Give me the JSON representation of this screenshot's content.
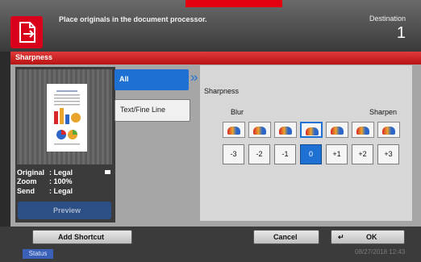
{
  "header": {
    "message": "Place originals in the document processor.",
    "destination_label": "Destination",
    "destination_count": "1"
  },
  "title": "Sharpness",
  "preview": {
    "original": {
      "label": "Original",
      "value": ": Legal"
    },
    "zoom": {
      "label": "Zoom",
      "value": ": 100%"
    },
    "send": {
      "label": "Send",
      "value": ": Legal"
    },
    "button_label": "Preview"
  },
  "modes": [
    {
      "label": "All",
      "selected": true
    },
    {
      "label": "Text/Fine Line",
      "selected": false
    }
  ],
  "sharpness": {
    "title": "Sharpness",
    "left_label": "Blur",
    "right_label": "Sharpen",
    "values": [
      "-3",
      "-2",
      "-1",
      "0",
      "+1",
      "+2",
      "+3"
    ],
    "selected": "0"
  },
  "footer": {
    "add_shortcut": "Add Shortcut",
    "cancel": "Cancel",
    "ok": "OK",
    "status": "Status",
    "datetime": "08/27/2018 12:43"
  },
  "colors": {
    "accent_blue": "#1f70d3",
    "title_red": "#c8191b",
    "panel_gray": "#a6a6a6"
  }
}
